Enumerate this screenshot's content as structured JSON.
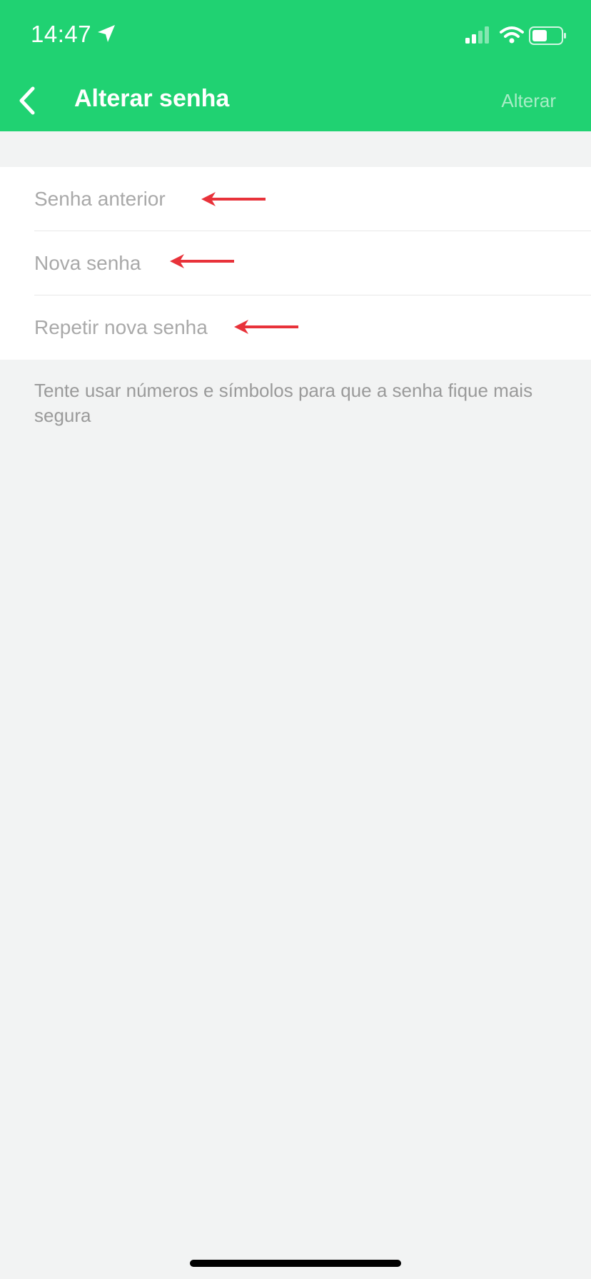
{
  "status_bar": {
    "time": "14:47",
    "icons": [
      "location-arrow-icon",
      "cellular-signal-icon",
      "wifi-icon",
      "battery-icon"
    ]
  },
  "header": {
    "back_icon": "chevron-left-icon",
    "title": "Alterar senha",
    "action_label": "Alterar"
  },
  "form": {
    "fields": [
      {
        "placeholder": "Senha anterior",
        "value": ""
      },
      {
        "placeholder": "Nova senha",
        "value": ""
      },
      {
        "placeholder": "Repetir nova senha",
        "value": ""
      }
    ]
  },
  "hint": "Tente usar números e símbolos para que a senha fique mais segura",
  "colors": {
    "header_bg": "#20d272",
    "page_bg": "#f2f3f3",
    "placeholder": "#a9a9a9",
    "annotation_arrow": "#e8323a"
  }
}
